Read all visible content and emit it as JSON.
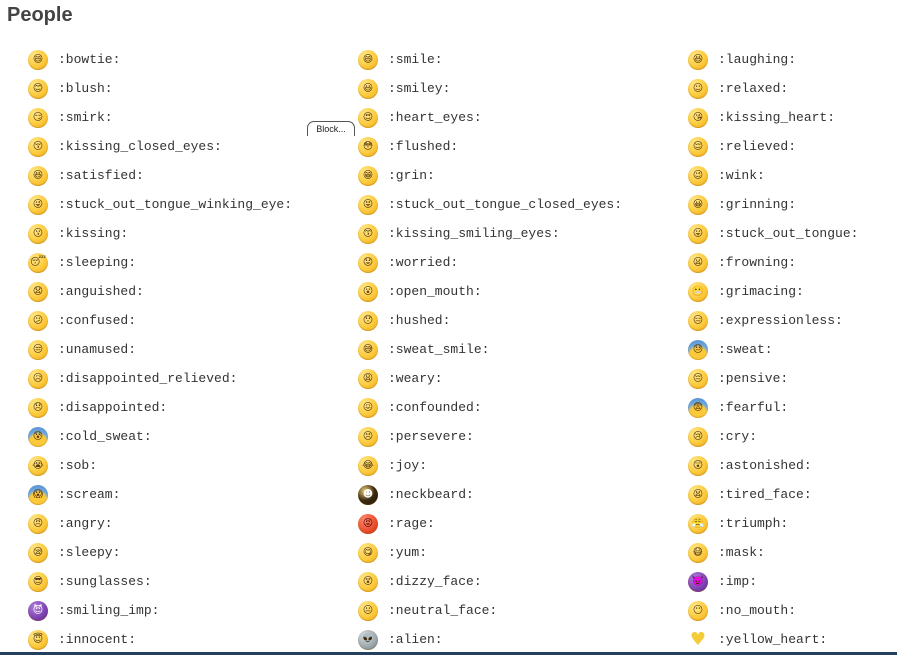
{
  "heading": "People",
  "block_tab": "Block...",
  "rows": [
    [
      {
        "icon": "bowtie-icon",
        "glyph": "😄",
        "code": ":bowtie:"
      },
      {
        "icon": "smile-icon",
        "glyph": "😄",
        "code": ":smile:"
      },
      {
        "icon": "laughing-icon",
        "glyph": "😆",
        "code": ":laughing:"
      }
    ],
    [
      {
        "icon": "blush-icon",
        "glyph": "😊",
        "code": ":blush:"
      },
      {
        "icon": "smiley-icon",
        "glyph": "😃",
        "code": ":smiley:"
      },
      {
        "icon": "relaxed-icon",
        "glyph": "☺",
        "code": ":relaxed:"
      }
    ],
    [
      {
        "icon": "smirk-icon",
        "glyph": "😏",
        "code": ":smirk:"
      },
      {
        "icon": "heart-eyes-icon",
        "glyph": "😍",
        "code": ":heart_eyes:"
      },
      {
        "icon": "kissing-heart-icon",
        "glyph": "😘",
        "code": ":kissing_heart:"
      }
    ],
    [
      {
        "icon": "kissing-closed-eyes-icon",
        "glyph": "😚",
        "code": ":kissing_closed_eyes:"
      },
      {
        "icon": "flushed-icon",
        "glyph": "😳",
        "code": ":flushed:"
      },
      {
        "icon": "relieved-icon",
        "glyph": "😌",
        "code": ":relieved:"
      }
    ],
    [
      {
        "icon": "satisfied-icon",
        "glyph": "😆",
        "code": ":satisfied:"
      },
      {
        "icon": "grin-icon",
        "glyph": "😁",
        "code": ":grin:"
      },
      {
        "icon": "wink-icon",
        "glyph": "😉",
        "code": ":wink:"
      }
    ],
    [
      {
        "icon": "stuck-out-tongue-winking-eye-icon",
        "glyph": "😜",
        "code": ":stuck_out_tongue_winking_eye:"
      },
      {
        "icon": "stuck-out-tongue-closed-eyes-icon",
        "glyph": "😝",
        "code": ":stuck_out_tongue_closed_eyes:"
      },
      {
        "icon": "grinning-icon",
        "glyph": "😀",
        "code": ":grinning:"
      }
    ],
    [
      {
        "icon": "kissing-icon",
        "glyph": "😗",
        "code": ":kissing:"
      },
      {
        "icon": "kissing-smiling-eyes-icon",
        "glyph": "😙",
        "code": ":kissing_smiling_eyes:"
      },
      {
        "icon": "stuck-out-tongue-icon",
        "glyph": "😛",
        "code": ":stuck_out_tongue:"
      }
    ],
    [
      {
        "icon": "sleeping-icon",
        "glyph": "😴",
        "code": ":sleeping:"
      },
      {
        "icon": "worried-icon",
        "glyph": "😟",
        "code": ":worried:"
      },
      {
        "icon": "frowning-icon",
        "glyph": "😦",
        "code": ":frowning:"
      }
    ],
    [
      {
        "icon": "anguished-icon",
        "glyph": "😧",
        "code": ":anguished:"
      },
      {
        "icon": "open-mouth-icon",
        "glyph": "😮",
        "code": ":open_mouth:"
      },
      {
        "icon": "grimacing-icon",
        "glyph": "😬",
        "code": ":grimacing:"
      }
    ],
    [
      {
        "icon": "confused-icon",
        "glyph": "😕",
        "code": ":confused:"
      },
      {
        "icon": "hushed-icon",
        "glyph": "😯",
        "code": ":hushed:"
      },
      {
        "icon": "expressionless-icon",
        "glyph": "😑",
        "code": ":expressionless:"
      }
    ],
    [
      {
        "icon": "unamused-icon",
        "glyph": "😒",
        "code": ":unamused:"
      },
      {
        "icon": "sweat-smile-icon",
        "glyph": "😅",
        "code": ":sweat_smile:"
      },
      {
        "icon": "sweat-icon",
        "glyph": "😓",
        "code": ":sweat:"
      }
    ],
    [
      {
        "icon": "disappointed-relieved-icon",
        "glyph": "😥",
        "code": ":disappointed_relieved:"
      },
      {
        "icon": "weary-icon",
        "glyph": "😩",
        "code": ":weary:"
      },
      {
        "icon": "pensive-icon",
        "glyph": "😔",
        "code": ":pensive:"
      }
    ],
    [
      {
        "icon": "disappointed-icon",
        "glyph": "😞",
        "code": ":disappointed:"
      },
      {
        "icon": "confounded-icon",
        "glyph": "😖",
        "code": ":confounded:"
      },
      {
        "icon": "fearful-icon",
        "glyph": "😨",
        "code": ":fearful:"
      }
    ],
    [
      {
        "icon": "cold-sweat-icon",
        "glyph": "😰",
        "code": ":cold_sweat:"
      },
      {
        "icon": "persevere-icon",
        "glyph": "😣",
        "code": ":persevere:"
      },
      {
        "icon": "cry-icon",
        "glyph": "😢",
        "code": ":cry:"
      }
    ],
    [
      {
        "icon": "sob-icon",
        "glyph": "😭",
        "code": ":sob:"
      },
      {
        "icon": "joy-icon",
        "glyph": "😂",
        "code": ":joy:"
      },
      {
        "icon": "astonished-icon",
        "glyph": "😲",
        "code": ":astonished:"
      }
    ],
    [
      {
        "icon": "scream-icon",
        "glyph": "😱",
        "code": ":scream:"
      },
      {
        "icon": "neckbeard-icon",
        "glyph": "☻",
        "code": ":neckbeard:"
      },
      {
        "icon": "tired-face-icon",
        "glyph": "😫",
        "code": ":tired_face:"
      }
    ],
    [
      {
        "icon": "angry-icon",
        "glyph": "😠",
        "code": ":angry:"
      },
      {
        "icon": "rage-icon",
        "glyph": "😡",
        "code": ":rage:"
      },
      {
        "icon": "triumph-icon",
        "glyph": "😤",
        "code": ":triumph:"
      }
    ],
    [
      {
        "icon": "sleepy-icon",
        "glyph": "😪",
        "code": ":sleepy:"
      },
      {
        "icon": "yum-icon",
        "glyph": "😋",
        "code": ":yum:"
      },
      {
        "icon": "mask-icon",
        "glyph": "😷",
        "code": ":mask:"
      }
    ],
    [
      {
        "icon": "sunglasses-icon",
        "glyph": "😎",
        "code": ":sunglasses:"
      },
      {
        "icon": "dizzy-face-icon",
        "glyph": "😵",
        "code": ":dizzy_face:"
      },
      {
        "icon": "imp-icon",
        "glyph": "👿",
        "code": ":imp:"
      }
    ],
    [
      {
        "icon": "smiling-imp-icon",
        "glyph": "😈",
        "code": ":smiling_imp:"
      },
      {
        "icon": "neutral-face-icon",
        "glyph": "😐",
        "code": ":neutral_face:"
      },
      {
        "icon": "no-mouth-icon",
        "glyph": "😶",
        "code": ":no_mouth:"
      }
    ],
    [
      {
        "icon": "innocent-icon",
        "glyph": "😇",
        "code": ":innocent:"
      },
      {
        "icon": "alien-icon",
        "glyph": "👽",
        "code": ":alien:"
      },
      {
        "icon": "yellow-heart-icon",
        "glyph": "♥",
        "code": ":yellow_heart:"
      }
    ]
  ]
}
